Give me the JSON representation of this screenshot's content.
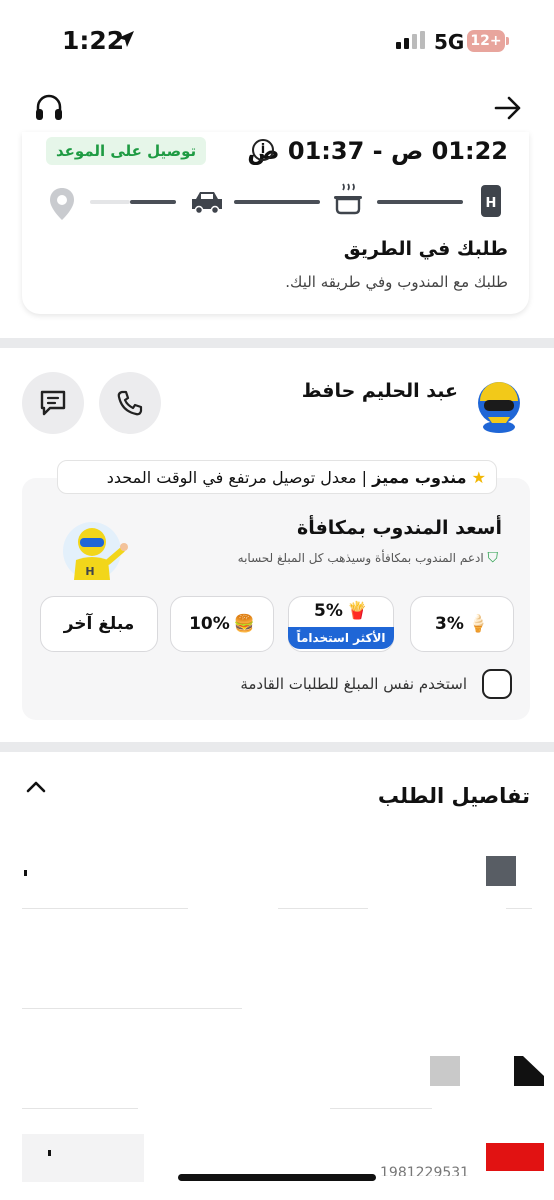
{
  "status_bar": {
    "time": "1:22",
    "network": "5G",
    "battery": "12+"
  },
  "tracking": {
    "eta": "01:22 ص - 01:37 ص",
    "badge": "توصيل على الموعد",
    "title": "طلبك في الطريق",
    "subtitle": "طلبك مع المندوب وفي طريقه اليك."
  },
  "courier": {
    "name": "عبد الحليم حافظ",
    "featured_label": "مندوب مميز",
    "featured_desc": "معدل توصيل مرتفع في الوقت المحدد"
  },
  "tip": {
    "title": "أسعد المندوب بمكافأة",
    "description": "ادعم المندوب بمكافأة وسيذهب كل المبلغ لحسابه",
    "options": [
      {
        "label": "3%",
        "emoji": "🍦"
      },
      {
        "label": "5%",
        "emoji": "🍟",
        "badge": "الأكثر استخداماً"
      },
      {
        "label": "10%",
        "emoji": "🍔"
      },
      {
        "label": "مبلغ آخر",
        "emoji": ""
      }
    ],
    "same_amount_label": "استخدم نفس المبلغ للطلبات القادمة",
    "same_amount_checked": false
  },
  "order_details": {
    "title": "تفاصيل الطلب",
    "partial_number": "1981229531"
  },
  "colors": {
    "accent_green": "#1e9b43",
    "accent_blue": "#1f66d6",
    "track_gray": "#4a4f57"
  }
}
